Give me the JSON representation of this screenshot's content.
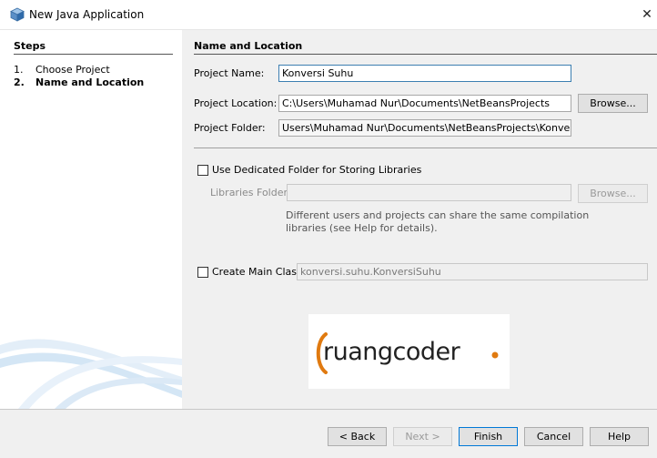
{
  "window": {
    "title": "New Java Application",
    "close_glyph": "✕"
  },
  "steps": {
    "title": "Steps",
    "items": [
      {
        "num": "1.",
        "label": "Choose Project",
        "active": false
      },
      {
        "num": "2.",
        "label": "Name and Location",
        "active": true
      }
    ]
  },
  "main": {
    "section_title": "Name and Location",
    "project_name": {
      "label": "Project Name:",
      "value": "Konversi Suhu"
    },
    "project_location": {
      "label": "Project Location:",
      "value": "C:\\Users\\Muhamad Nur\\Documents\\NetBeansProjects",
      "browse": "Browse..."
    },
    "project_folder": {
      "label": "Project Folder:",
      "value": "Users\\Muhamad Nur\\Documents\\NetBeansProjects\\Konversi Suhu"
    },
    "dedicated_folder": {
      "label": "Use Dedicated Folder for Storing Libraries",
      "checked": false
    },
    "libraries_folder": {
      "label": "Libraries Folder:",
      "value": "",
      "browse": "Browse..."
    },
    "help_text": {
      "line1": "Different users and projects can share the same compilation",
      "line2": "libraries (see Help for details)."
    },
    "main_class": {
      "label": "Create Main Class",
      "checked": false,
      "value": "konversi.suhu.KonversiSuhu"
    },
    "logo": {
      "text_prefix": "r",
      "text_rest": "uangcode",
      "text_end": "r",
      "accent": "#e07a10"
    }
  },
  "footer": {
    "back": "< Back",
    "next": "Next >",
    "finish": "Finish",
    "cancel": "Cancel",
    "help": "Help"
  },
  "colors": {
    "accent": "#0078d7",
    "logo_orange": "#e07a10"
  }
}
